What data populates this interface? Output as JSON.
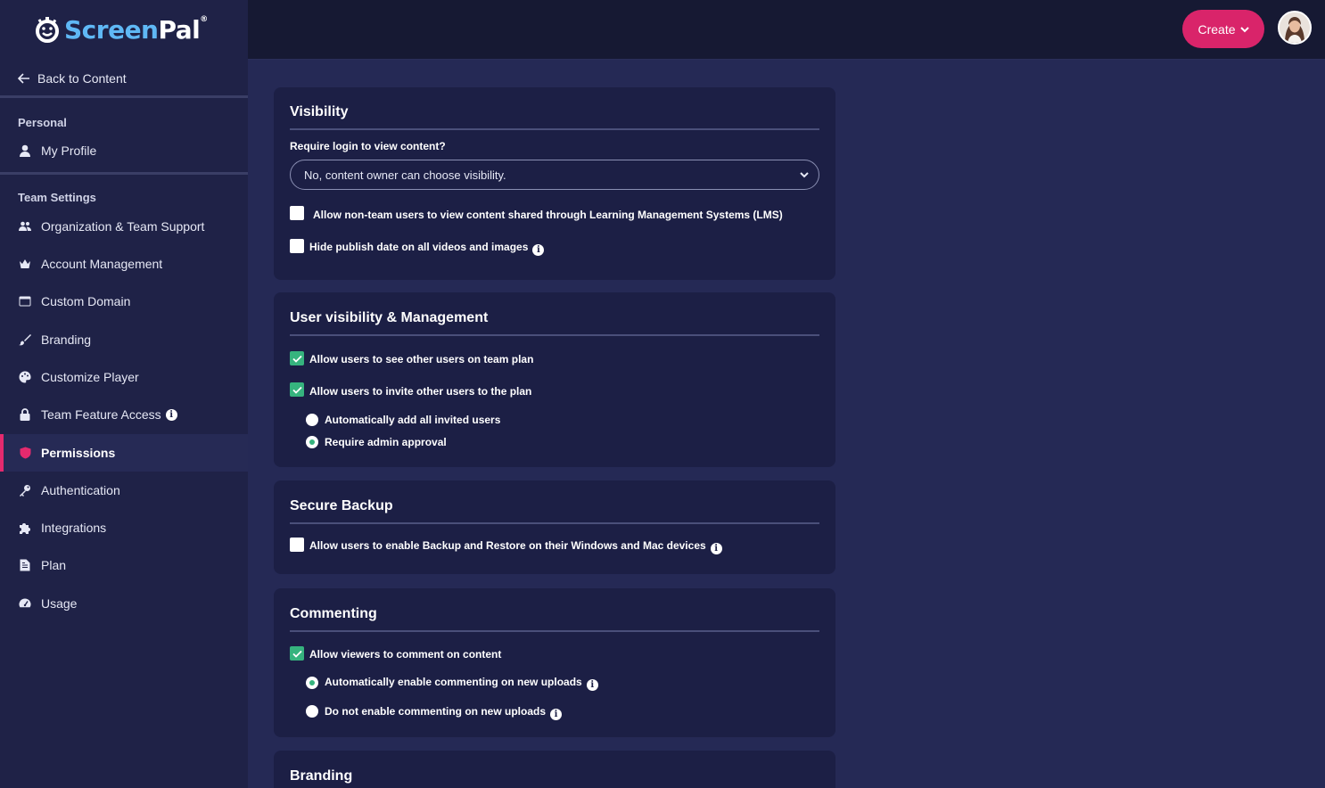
{
  "brand": {
    "screen": "Screen",
    "pal": "Pal",
    "reg": "®"
  },
  "sidebar": {
    "back_label": "Back to Content",
    "personal_title": "Personal",
    "my_profile": "My Profile",
    "team_title": "Team Settings",
    "items": [
      {
        "label": "Organization & Team Support",
        "icon": "users-icon"
      },
      {
        "label": "Account Management",
        "icon": "crown-icon"
      },
      {
        "label": "Custom Domain",
        "icon": "window-icon"
      },
      {
        "label": "Branding",
        "icon": "brush-icon"
      },
      {
        "label": "Customize Player",
        "icon": "palette-icon"
      },
      {
        "label": "Team Feature Access",
        "icon": "lock-icon"
      },
      {
        "label": "Permissions",
        "icon": "shield-icon",
        "active": true
      },
      {
        "label": "Authentication",
        "icon": "key-icon"
      },
      {
        "label": "Integrations",
        "icon": "puzzle-icon"
      },
      {
        "label": "Plan",
        "icon": "document-icon"
      },
      {
        "label": "Usage",
        "icon": "gauge-icon"
      }
    ]
  },
  "topbar": {
    "create_label": "Create"
  },
  "visibility": {
    "title": "Visibility",
    "require_login_label": "Require login to view content?",
    "require_login_value": "No, content owner can choose visibility.",
    "lms_label": "Allow non-team users to view content shared through Learning Management Systems (LMS)",
    "lms_checked": false,
    "hide_date_label": "Hide publish date on all videos and images",
    "hide_date_checked": false
  },
  "user_visibility": {
    "title": "User visibility & Management",
    "see_users_label": "Allow users to see other users on team plan",
    "see_users_checked": true,
    "invite_label": "Allow users to invite other users to the plan",
    "invite_checked": true,
    "auto_add_label": "Automatically add all invited users",
    "admin_approval_label": "Require admin approval",
    "selected": "admin_approval"
  },
  "secure_backup": {
    "title": "Secure Backup",
    "backup_label": "Allow users to enable Backup and Restore on their Windows and Mac devices",
    "backup_checked": false
  },
  "commenting": {
    "title": "Commenting",
    "allow_label": "Allow viewers to comment on content",
    "allow_checked": true,
    "auto_enable_label": "Automatically enable commenting on new uploads",
    "no_enable_label": "Do not enable commenting on new uploads",
    "selected": "auto_enable"
  },
  "branding": {
    "title": "Branding"
  },
  "colors": {
    "accent": "#d9246a",
    "check": "#36b37e",
    "sidebar": "#1f2247",
    "content": "#252955",
    "card": "#1c1f45"
  }
}
